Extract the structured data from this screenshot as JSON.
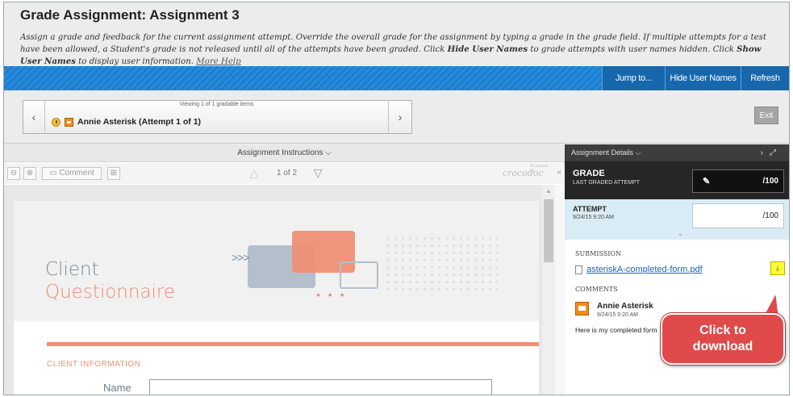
{
  "page": {
    "title": "Grade Assignment: Assignment 3",
    "instructions_parts": [
      "Assign a grade and feedback for the current assignment attempt. Override the overall grade for the assignment by typing a grade in the grade field. If multiple attempts for a test have been allowed, a Student's grade is not released until all of the attempts have been graded. Click ",
      "Hide User Names",
      " to grade attempts with user names hidden. Click ",
      "Show User Names",
      " to display user information. ",
      "More Help"
    ]
  },
  "toolbar": {
    "jump_to": "Jump to...",
    "hide_user_names": "Hide User Names",
    "refresh": "Refresh"
  },
  "navigator": {
    "viewing_text": "Viewing 1 of 1 gradable items",
    "student_attempt": "Annie Asterisk (Attempt 1 of 1)",
    "prev_icon": "‹",
    "next_icon": "›",
    "exit_label": "Exit"
  },
  "document": {
    "instructions_label": "Assignment Instructions",
    "comment_label": "Comment",
    "page_indicator": "1 of 2",
    "powered_by": "Powered by",
    "brand": "crocodoc",
    "arrows_glyph": ">>>",
    "dots_glyph": "• • •",
    "heading_line1": "Client",
    "heading_line2": "Questionnaire",
    "section_label": "CLIENT INFORMATION",
    "name_label": "Name",
    "name_value": ""
  },
  "details": {
    "header": "Assignment Details",
    "grade_title": "GRADE",
    "grade_subtitle": "LAST GRADED ATTEMPT",
    "grade_value": "/100",
    "attempt_title": "ATTEMPT",
    "attempt_date": "9/24/15 9:20 AM",
    "attempt_value": "/100",
    "submission_label": "SUBMISSION",
    "file_name": "asteriskA-completed-form.pdf",
    "comments_label": "COMMENTS",
    "comment_author": "Annie Asterisk",
    "comment_date": "9/24/15 9:20 AM",
    "comment_text": "Here is my completed form"
  },
  "callout": {
    "line1": "Click to",
    "line2": "download"
  },
  "colors": {
    "toolbar_blue": "#1b7ed0",
    "accent_orange": "#ef8f76",
    "callout_red": "#e04a4a",
    "download_highlight": "#ffff33"
  }
}
